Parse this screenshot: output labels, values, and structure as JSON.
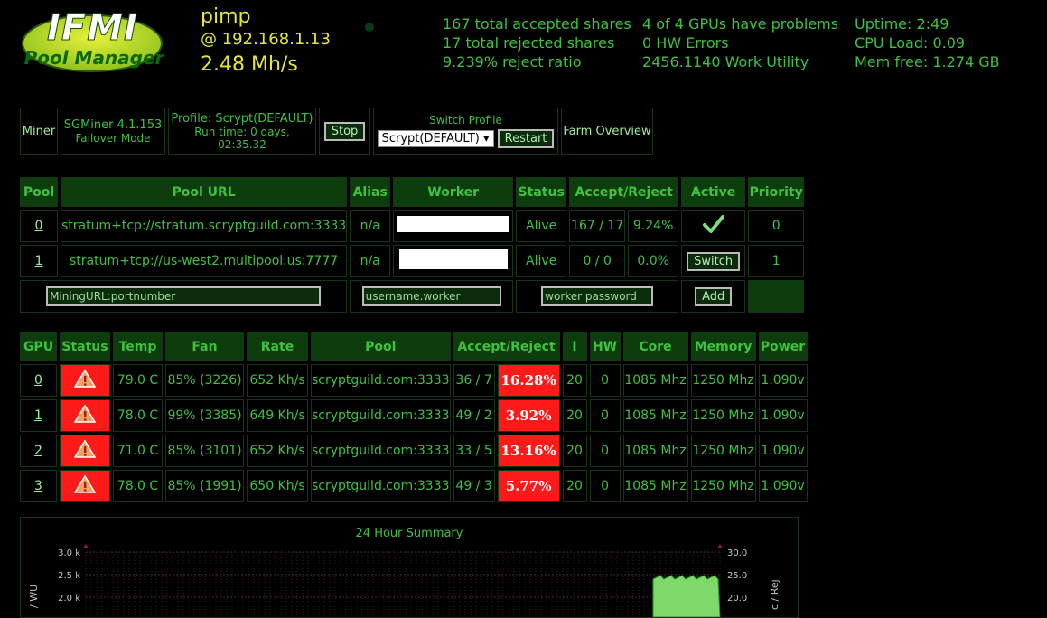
{
  "logo": {
    "line1": "IFMI",
    "line2": "Pool Manager"
  },
  "host": {
    "name": "pimp",
    "ip": "@ 192.168.1.13",
    "hashrate": "2.48 Mh/s"
  },
  "stats": {
    "col1": [
      "167 total accepted shares",
      "17 total rejected shares",
      "9.239% reject ratio"
    ],
    "col2": [
      "4 of 4 GPUs have problems",
      "0 HW Errors",
      "2456.1140 Work Utility"
    ],
    "col3": [
      "Uptime: 2:49",
      "CPU Load: 0.09",
      "Mem free: 1.274 GB"
    ]
  },
  "minerbar": {
    "miner_link": "Miner",
    "version": "SGMiner 4.1.153",
    "mode": "Failover Mode",
    "profile": "Profile: Scrypt(DEFAULT)",
    "runtime": "Run time: 0 days, 02:35.32",
    "stop": "Stop",
    "switch_profile": "Switch Profile",
    "profile_select": "Scrypt(DEFAULT)",
    "restart": "Restart",
    "farm": "Farm Overview"
  },
  "pools": {
    "headers": [
      "Pool",
      "Pool URL",
      "Alias",
      "Worker",
      "Status",
      "Accept/Reject",
      "Active",
      "Priority"
    ],
    "rows": [
      {
        "id": "0",
        "url": "stratum+tcp://stratum.scryptguild.com:3333",
        "alias": "n/a",
        "status": "Alive",
        "ar": "167 / 17",
        "pct": "9.24%",
        "priority": "0"
      },
      {
        "id": "1",
        "url": "stratum+tcp://us-west2.multipool.us:7777",
        "alias": "n/a",
        "status": "Alive",
        "ar": "0 / 0",
        "pct": "0.0%",
        "switch": "Switch",
        "priority": "1"
      }
    ],
    "new": {
      "url_ph": "MiningURL:portnumber",
      "user_ph": "username.worker",
      "pass_ph": "worker password",
      "add": "Add"
    }
  },
  "gpus": {
    "headers": [
      "GPU",
      "Status",
      "Temp",
      "Fan",
      "Rate",
      "Pool",
      "Accept/Reject",
      "I",
      "HW",
      "Core",
      "Memory",
      "Power"
    ],
    "rows": [
      {
        "id": "0",
        "temp": "79.0 C",
        "fan": "85% (3226)",
        "rate": "652 Kh/s",
        "pool": "scryptguild.com:3333",
        "ar": "36 / 7",
        "rej": "16.28%",
        "i": "20",
        "hw": "0",
        "core": "1085 Mhz",
        "mem": "1250 Mhz",
        "power": "1.090v"
      },
      {
        "id": "1",
        "temp": "78.0 C",
        "fan": "99% (3385)",
        "rate": "649 Kh/s",
        "pool": "scryptguild.com:3333",
        "ar": "49 / 2",
        "rej": "3.92%",
        "i": "20",
        "hw": "0",
        "core": "1085 Mhz",
        "mem": "1250 Mhz",
        "power": "1.090v"
      },
      {
        "id": "2",
        "temp": "71.0 C",
        "fan": "85% (3101)",
        "rate": "652 Kh/s",
        "pool": "scryptguild.com:3333",
        "ar": "33 / 5",
        "rej": "13.16%",
        "i": "20",
        "hw": "0",
        "core": "1085 Mhz",
        "mem": "1250 Mhz",
        "power": "1.090v"
      },
      {
        "id": "3",
        "temp": "78.0 C",
        "fan": "85% (1991)",
        "rate": "650 Kh/s",
        "pool": "scryptguild.com:3333",
        "ar": "49 / 3",
        "rej": "5.77%",
        "i": "20",
        "hw": "0",
        "core": "1085 Mhz",
        "mem": "1250 Mhz",
        "power": "1.090v"
      }
    ]
  },
  "chart_data": {
    "type": "area",
    "title": "24 Hour Summary",
    "ylabel": "/ WU",
    "y2label": "c / Rej",
    "yticks": [
      "3.0 k",
      "2.5 k",
      "2.0 k"
    ],
    "y2ticks": [
      "30.0",
      "25.0",
      "20.0"
    ]
  }
}
